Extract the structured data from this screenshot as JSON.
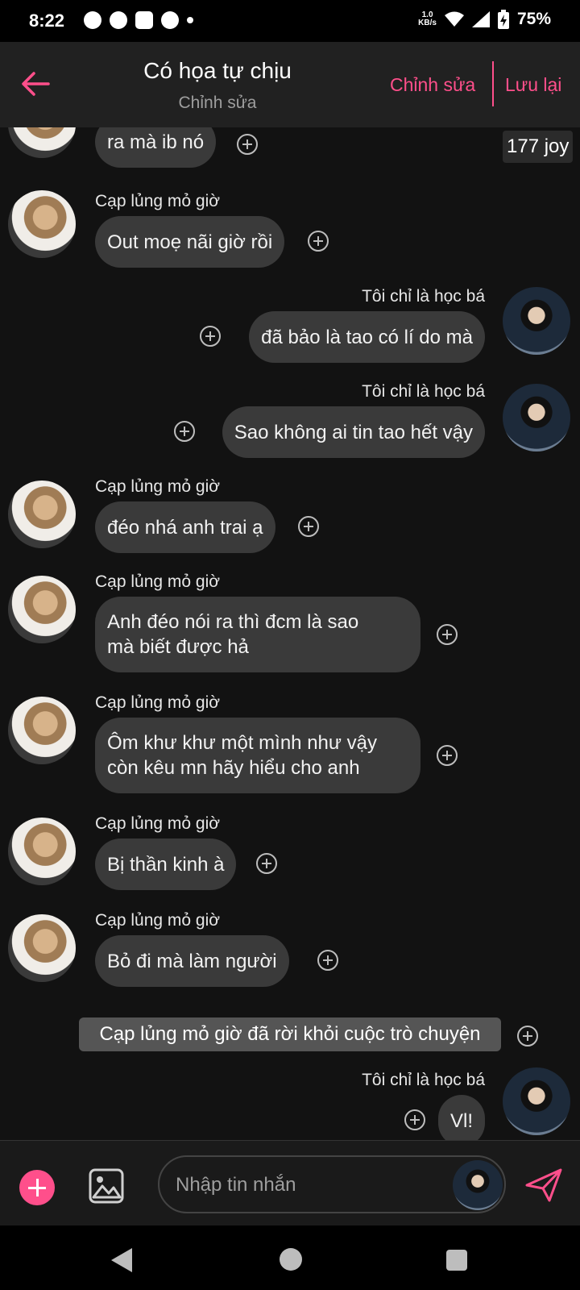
{
  "status_bar": {
    "time": "8:22",
    "net_speed_value": "1.0",
    "net_speed_unit": "KB/s",
    "battery": "75%"
  },
  "header": {
    "title": "Có họa tự chịu",
    "subtitle": "Chỉnh sửa",
    "edit_label": "Chỉnh sửa",
    "save_label": "Lưu lại"
  },
  "badge": {
    "joy": "177 joy"
  },
  "messages": [
    {
      "side": "left",
      "sender": "",
      "text": "ra mà ib nó"
    },
    {
      "side": "left",
      "sender": "Cạp lủng mỏ giờ",
      "text": "Out moẹ nãi giờ rồi"
    },
    {
      "side": "right",
      "sender": "Tôi chỉ là học bá",
      "text": "đã bảo là tao có lí do mà"
    },
    {
      "side": "right",
      "sender": "Tôi chỉ là học bá",
      "text": "Sao không ai tin tao hết vậy"
    },
    {
      "side": "left",
      "sender": "Cạp lủng mỏ giờ",
      "text": "đéo nhá anh trai ạ"
    },
    {
      "side": "left",
      "sender": "Cạp lủng mỏ giờ",
      "line1": "Anh đéo nói ra thì đcm là sao",
      "line2": "mà biết được hả"
    },
    {
      "side": "left",
      "sender": "Cạp lủng mỏ giờ",
      "line1": "Ôm khư khư một mình như vậy",
      "line2": "còn kêu mn hãy hiểu cho anh"
    },
    {
      "side": "left",
      "sender": "Cạp lủng mỏ giờ",
      "text": "Bị thần kinh à"
    },
    {
      "side": "left",
      "sender": "Cạp lủng mỏ giờ",
      "text": "Bỏ đi mà làm người"
    },
    {
      "side": "right",
      "sender": "Tôi chỉ là học bá",
      "text": "Vl!"
    }
  ],
  "system_message": "Cạp lủng mỏ giờ đã rời khỏi cuộc trò chuyện",
  "input": {
    "placeholder": "Nhập tin nhắn"
  },
  "colors": {
    "accent": "#ff4f8b",
    "background": "#121212",
    "bubble": "#3a3a3a"
  }
}
